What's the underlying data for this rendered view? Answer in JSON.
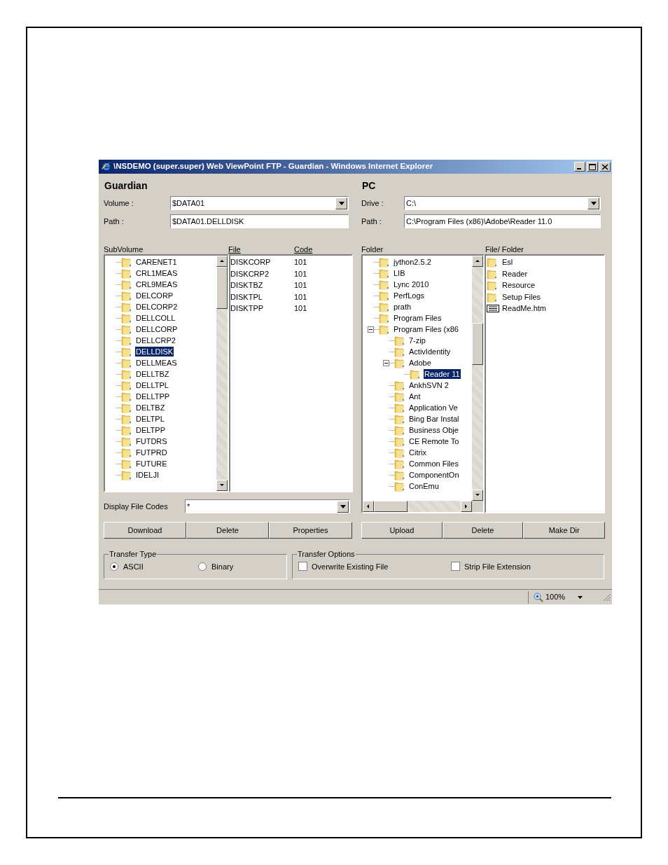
{
  "window": {
    "title": "\\NSDEMO (super.super) Web ViewPoint FTP - Guardian - Windows Internet Explorer"
  },
  "guardian": {
    "heading": "Guardian",
    "volume": {
      "label": "Volume :",
      "value": "$DATA01"
    },
    "path": {
      "label": "Path :",
      "value": "$DATA01.DELLDISK"
    },
    "subvolume": {
      "label": "SubVolume",
      "items": [
        {
          "name": "CARENET1",
          "selected": false
        },
        {
          "name": "CRL1MEAS",
          "selected": false
        },
        {
          "name": "CRL9MEAS",
          "selected": false
        },
        {
          "name": "DELCORP",
          "selected": false
        },
        {
          "name": "DELCORP2",
          "selected": false
        },
        {
          "name": "DELLCOLL",
          "selected": false
        },
        {
          "name": "DELLCORP",
          "selected": false
        },
        {
          "name": "DELLCRP2",
          "selected": false
        },
        {
          "name": "DELLDISK",
          "selected": true
        },
        {
          "name": "DELLMEAS",
          "selected": false
        },
        {
          "name": "DELLTBZ",
          "selected": false
        },
        {
          "name": "DELLTPL",
          "selected": false
        },
        {
          "name": "DELLTPP",
          "selected": false
        },
        {
          "name": "DELTBZ",
          "selected": false
        },
        {
          "name": "DELTPL",
          "selected": false
        },
        {
          "name": "DELTPP",
          "selected": false
        },
        {
          "name": "FUTDRS",
          "selected": false
        },
        {
          "name": "FUTPRD",
          "selected": false
        },
        {
          "name": "FUTURE",
          "selected": false
        },
        {
          "name": "IDELJI",
          "selected": false
        }
      ]
    },
    "files": {
      "columns": [
        "File",
        "Code"
      ],
      "rows": [
        [
          "DISKCORP",
          "101"
        ],
        [
          "DISKCRP2",
          "101"
        ],
        [
          "DISKTBZ",
          "101"
        ],
        [
          "DISKTPL",
          "101"
        ],
        [
          "DISKTPP",
          "101"
        ]
      ]
    },
    "display_file_codes": {
      "label": "Display File Codes",
      "value": "*"
    },
    "buttons": [
      "Download",
      "Delete",
      "Properties"
    ]
  },
  "pc": {
    "heading": "PC",
    "drive": {
      "label": "Drive :",
      "value": "C:\\"
    },
    "path": {
      "label": "Path :",
      "value": "C:\\Program Files (x86)\\Adobe\\Reader 11.0"
    },
    "folder": {
      "label": "Folder",
      "items": [
        {
          "name": "jython2.5.2",
          "selected": false
        },
        {
          "name": "LIB",
          "selected": false
        },
        {
          "name": "Lync 2010",
          "selected": false
        },
        {
          "name": "PerfLogs",
          "selected": false
        },
        {
          "name": "prath",
          "selected": false
        },
        {
          "name": "Program Files",
          "selected": false
        },
        {
          "name": "Program Files (x86",
          "selected": false,
          "expanded": true,
          "children": [
            {
              "name": "7-zip",
              "selected": false
            },
            {
              "name": "ActivIdentity",
              "selected": false
            },
            {
              "name": "Adobe",
              "selected": false,
              "expanded": true,
              "children": [
                {
                  "name": "Reader 11",
                  "selected": true
                }
              ]
            },
            {
              "name": "AnkhSVN 2",
              "selected": false
            },
            {
              "name": "Ant",
              "selected": false
            },
            {
              "name": "Application Ve",
              "selected": false
            },
            {
              "name": "Bing Bar Instal",
              "selected": false
            },
            {
              "name": "Business Obje",
              "selected": false
            },
            {
              "name": "CE Remote To",
              "selected": false
            },
            {
              "name": "Citrix",
              "selected": false
            },
            {
              "name": "Common Files",
              "selected": false
            },
            {
              "name": "ComponentOn",
              "selected": false
            },
            {
              "name": "ConEmu",
              "selected": false
            }
          ]
        }
      ]
    },
    "file_folder": {
      "label": "File/ Folder",
      "items": [
        {
          "name": "Esl",
          "kind": "folder"
        },
        {
          "name": "Reader",
          "kind": "folder"
        },
        {
          "name": "Resource",
          "kind": "folder"
        },
        {
          "name": "Setup Files",
          "kind": "folder"
        },
        {
          "name": "ReadMe.htm",
          "kind": "file"
        }
      ]
    },
    "buttons": [
      "Upload",
      "Delete",
      "Make Dir"
    ]
  },
  "transfer_type": {
    "label": "Transfer Type",
    "options": [
      {
        "label": "ASCII",
        "selected": true
      },
      {
        "label": "Binary",
        "selected": false
      }
    ]
  },
  "transfer_options": {
    "label": "Transfer Options",
    "options": [
      {
        "label": "Overwrite Existing File",
        "checked": false
      },
      {
        "label": "Strip File Extension",
        "checked": false
      }
    ]
  },
  "status_bar": {
    "zoom": "100%"
  }
}
